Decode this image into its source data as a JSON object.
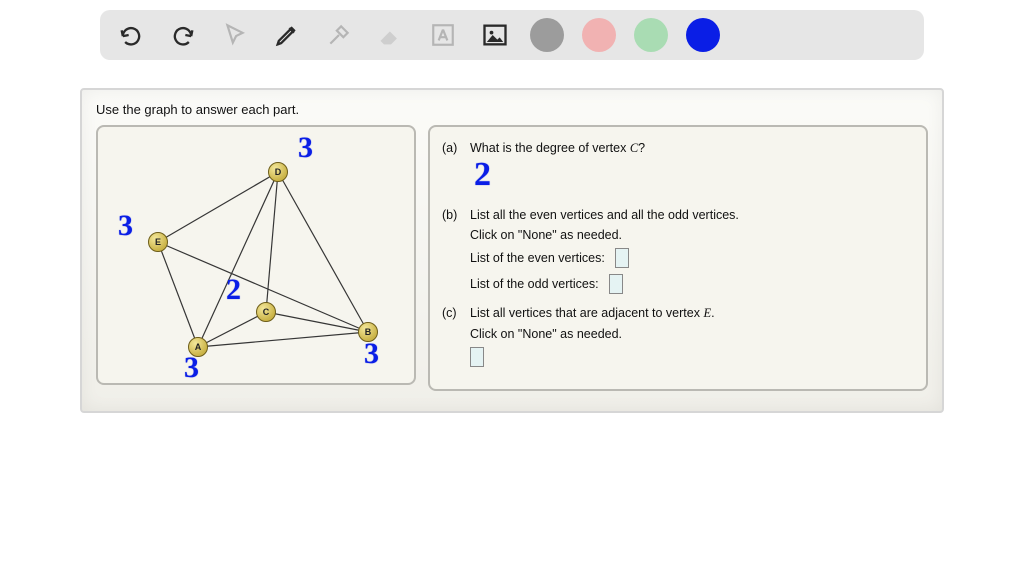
{
  "toolbar": {
    "swatch_colors": [
      "#9c9c9c",
      "#f1b2b2",
      "#a9dcb3",
      "#0a1ee6"
    ]
  },
  "instruction": "Use the graph to answer each part.",
  "graph": {
    "vertices": {
      "A": {
        "label": "A"
      },
      "B": {
        "label": "B"
      },
      "C": {
        "label": "C"
      },
      "D": {
        "label": "D"
      },
      "E": {
        "label": "E"
      }
    },
    "hand_labels": {
      "d": "3",
      "e": "3",
      "a": "3",
      "b": "3",
      "c": "2"
    }
  },
  "questions": {
    "a": {
      "label": "(a)",
      "text_pre": "What is the degree of vertex ",
      "var": "C",
      "text_post": "?",
      "hand_answer": "2"
    },
    "b": {
      "label": "(b)",
      "line1": "List all the even vertices and all the odd vertices.",
      "line2": "Click on \"None\" as needed.",
      "even_label": "List of the even vertices:",
      "odd_label": "List of the odd vertices:"
    },
    "c": {
      "label": "(c)",
      "text_pre": "List all vertices that are adjacent to vertex ",
      "var": "E",
      "text_post": ".",
      "line2": "Click on \"None\" as needed."
    }
  }
}
